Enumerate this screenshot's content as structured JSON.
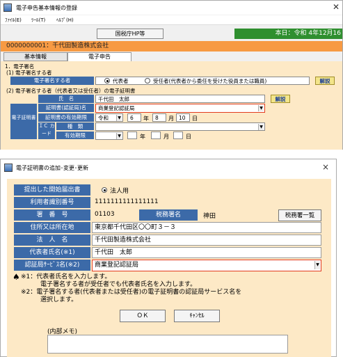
{
  "main_window": {
    "title": "電子申告基本情報の登録",
    "menu": [
      "ﾌｧｲﾙ(E)",
      "ﾂｰﾙ(T)",
      "ﾍﾙﾌﾟ(H)"
    ],
    "hp_button": "国税庁HP等",
    "date_text": "本日：令和 4年12月16",
    "company": "0000000001：千代田製造株式会社",
    "tabs": [
      "基本情報",
      "電子申告"
    ],
    "sec1_title": "1．電子署名",
    "sec1_sub": "(1) 電子署名する者",
    "signer_label": "電子署名する者",
    "radio_rep": "代表者",
    "radio_other": "受任者(代表者から委任を受けた役員または職員)",
    "explain": "解説",
    "sec2_title": "(2) 電子署名する者（代表者又は受任者）の電子証明書",
    "name_label": "氏　名",
    "name_value": "千代田　太郎",
    "side_label": "電子証明書",
    "issuer_label": "証明書(認証局)名",
    "issuer_value": "商業登記認証局",
    "expiry_label": "証明書の有効期限",
    "expiry_era": "令和",
    "expiry_year": "6",
    "expiry_nen": "年",
    "expiry_month": "8",
    "expiry_tsuki": "月",
    "expiry_day": "10",
    "expiry_nichi": "日",
    "ic_label": "ＩＣ カード",
    "type_label": "種　類",
    "valid_label": "有効期限",
    "valid_nen": "年",
    "valid_tsuki": "月",
    "valid_nichi": "日"
  },
  "dialog": {
    "title": "電子証明書の追加･変更･更新",
    "close": "×",
    "rows": {
      "filing_label": "提出した開始届出書",
      "filing_value": "法人用",
      "userid_label": "利用者識別番号",
      "userid_value": "1111111111111111",
      "office_num_label": "署　番　号",
      "office_num_value": "01103",
      "office_name_label": "税務署名",
      "office_name_value": "神田",
      "office_list_button": "税務署一覧",
      "address_label": "住所又は所在地",
      "address_value": "東京都千代田区〇〇町３－３",
      "corp_label": "法　人　名",
      "corp_value": "千代田製造株式会社",
      "rep_label": "代表者氏名(※1)",
      "rep_value": "千代田　太郎",
      "ca_label": "認証局ｻｰﾋﾞｽ名(※2)",
      "ca_value": "商業登記認証局"
    },
    "notes": {
      "spade": "♠",
      "n1_line1": "※1：代表者氏名を入力します。",
      "n1_line2": "電子署名する者が受任者でも代表者氏名を入力します。",
      "n2_line1": "※2：電子署名する者(代表者または受任者)の電子証明書の認証局サービス名を",
      "n2_line2": "選択します。"
    },
    "ok": "ＯＫ",
    "cancel": "ｷｬﾝｾﾙ",
    "memo_label": "(内部メモ)"
  }
}
